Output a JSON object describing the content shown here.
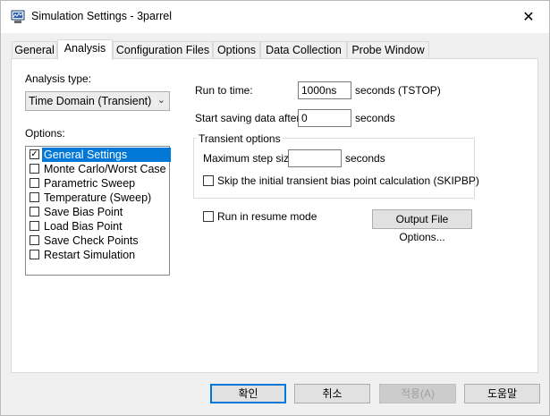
{
  "window": {
    "title": "Simulation Settings - 3parrel",
    "close_glyph": "✕"
  },
  "tabs": [
    {
      "label": "General"
    },
    {
      "label": "Analysis"
    },
    {
      "label": "Configuration Files"
    },
    {
      "label": "Options"
    },
    {
      "label": "Data Collection"
    },
    {
      "label": "Probe Window"
    }
  ],
  "active_tab": "Analysis",
  "analysis": {
    "analysis_type_label": "Analysis type:",
    "analysis_type_value": "Time Domain (Transient)",
    "options_label": "Options:",
    "options": [
      {
        "label": "General Settings",
        "checked": true,
        "selected": true
      },
      {
        "label": "Monte Carlo/Worst Case",
        "checked": false,
        "selected": false
      },
      {
        "label": "Parametric Sweep",
        "checked": false,
        "selected": false
      },
      {
        "label": "Temperature (Sweep)",
        "checked": false,
        "selected": false
      },
      {
        "label": "Save Bias Point",
        "checked": false,
        "selected": false
      },
      {
        "label": "Load Bias Point",
        "checked": false,
        "selected": false
      },
      {
        "label": "Save Check Points",
        "checked": false,
        "selected": false
      },
      {
        "label": "Restart Simulation",
        "checked": false,
        "selected": false
      }
    ],
    "run_to_time_label": "Run to time:",
    "run_to_time_value": "1000ns",
    "run_to_time_unit": "seconds  (TSTOP)",
    "start_saving_label": "Start saving data after:",
    "start_saving_value": "0",
    "start_saving_unit": "seconds",
    "transient_group_title": "Transient options",
    "max_step_label": "Maximum step size:",
    "max_step_value": "",
    "max_step_unit": "seconds",
    "skip_bias_label": "Skip the initial transient bias point calculation  (SKIPBP)",
    "skip_bias_checked": false,
    "resume_label": "Run in resume mode",
    "resume_checked": false,
    "output_file_options_label": "Output File Options..."
  },
  "footer": {
    "ok_label": "확인",
    "cancel_label": "취소",
    "apply_label": "적용(A)",
    "help_label": "도움말"
  },
  "colors": {
    "selection": "#0078d7",
    "default_button_border": "#0078d7"
  },
  "icons": {
    "app": "simulation-app-icon",
    "close": "close-icon",
    "dropdown": "chevron-down-icon",
    "check": "checkmark-icon"
  }
}
